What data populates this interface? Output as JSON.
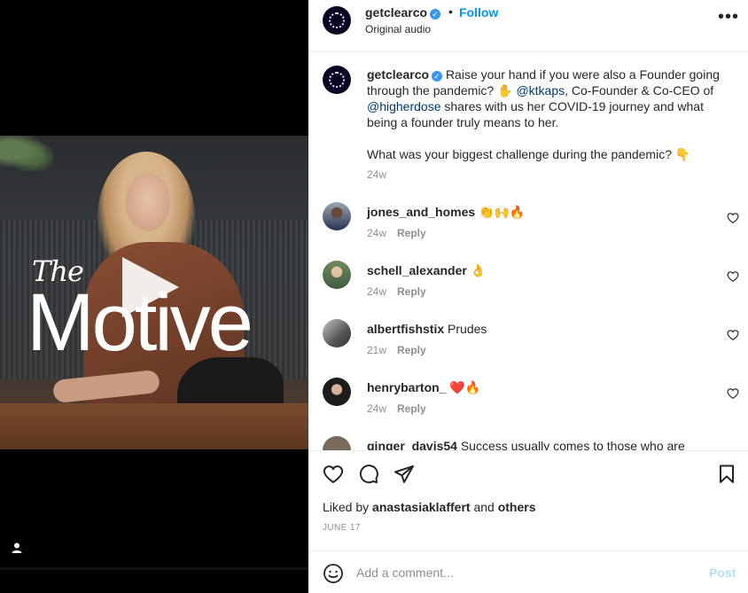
{
  "media": {
    "title_small": "The",
    "title_large": "Motive"
  },
  "header": {
    "username": "getclearco",
    "verified_mark": "✓",
    "separator": "•",
    "follow_label": "Follow",
    "audio_label": "Original audio",
    "more_label": "•••"
  },
  "caption": {
    "username": "getclearco",
    "text_before_1": "Raise your hand if you were also a Founder going through the pandemic? ✋ ",
    "mention_1": "@ktkaps",
    "text_mid": ", Co-Founder & Co-CEO of ",
    "mention_2": "@higherdose",
    "text_after": " shares with us her COVID-19 journey and what being a founder truly means to her.",
    "question": "What was your biggest challenge during the pandemic? 👇",
    "age": "24w"
  },
  "comments": [
    {
      "username": "jones_and_homes",
      "text": "👏🙌🔥",
      "age": "24w",
      "reply": "Reply"
    },
    {
      "username": "schell_alexander",
      "text": "👌",
      "age": "24w",
      "reply": "Reply"
    },
    {
      "username": "albertfishstix",
      "text": "Prudes",
      "age": "21w",
      "reply": "Reply"
    },
    {
      "username": "henrybarton_",
      "text": "❤️🔥",
      "age": "24w",
      "reply": "Reply"
    },
    {
      "username": "ginger_davis54",
      "text": "Success usually comes to those who are",
      "age": "",
      "reply": ""
    }
  ],
  "likes": {
    "prefix": "Liked by",
    "user": "anastasiaklaffert",
    "conj": "and",
    "others": "others"
  },
  "date": "JUNE 17",
  "add_comment": {
    "placeholder": "Add a comment...",
    "post_label": "Post"
  },
  "icons": {
    "like": "heart-icon",
    "comment": "comment-icon",
    "share": "paper-plane-icon",
    "save": "bookmark-icon",
    "emoji": "smiley-icon",
    "user_tag": "user-icon",
    "play": "play-icon"
  },
  "colors": {
    "link": "#0095f6",
    "verified": "#3897f0",
    "mention": "#00376b",
    "post_disabled": "#b2dffc"
  }
}
